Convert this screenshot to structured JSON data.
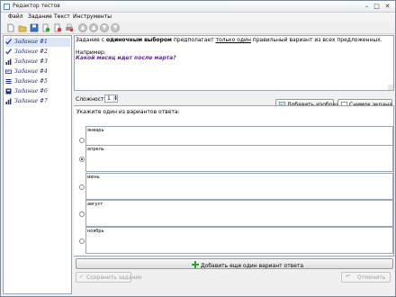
{
  "window": {
    "title": "Редактор тестов",
    "minimize": "–",
    "maximize": "□",
    "close": "✕"
  },
  "menu": [
    "Файл",
    "Задание",
    "Текст",
    "Инструменты"
  ],
  "toolbar": {
    "icons": [
      "new-file-icon",
      "open-folder-icon",
      "save-icon",
      "add-task-icon",
      "delete-task-icon",
      "print-icon"
    ],
    "nav": [
      "▲",
      "▲",
      "▼",
      "▼"
    ]
  },
  "tasks": [
    {
      "label": "Задание #1",
      "icon": "checkmark-icon"
    },
    {
      "label": "Задание #2",
      "icon": "checkmark-icon"
    },
    {
      "label": "Задание #3",
      "icon": "bar-chart-icon"
    },
    {
      "label": "Задание #4",
      "icon": "textfield-icon"
    },
    {
      "label": "Задание #5",
      "icon": "list-icon"
    },
    {
      "label": "Задание #6",
      "icon": "graduation-icon"
    },
    {
      "label": "Задание #7",
      "icon": "bar-chart-icon"
    }
  ],
  "description": {
    "part1": "Задание с ",
    "bold": "одиночным выбором",
    "part2": " предполагает ",
    "underlined": "только один",
    "part3": " правильный вариант из всех предложенных.",
    "example_label": "Например:",
    "question": "Какой месяц идет после марта?"
  },
  "settings": {
    "difficulty_label": "Сложность:",
    "difficulty_value": "1",
    "add_image": "Добавить изображение",
    "screenshot": "Снимок экрана"
  },
  "answers": {
    "hint": "Укажите один из вариантов ответа:",
    "items": [
      {
        "text": "январь",
        "selected": false
      },
      {
        "text": "апрель",
        "selected": true
      },
      {
        "text": "июнь",
        "selected": false
      },
      {
        "text": "август",
        "selected": false
      },
      {
        "text": "ноябрь",
        "selected": false
      }
    ],
    "add_variant": "Добавить еще один вариант ответа"
  },
  "bottom": {
    "save": "Сохранить задание",
    "cancel": "Отменить"
  },
  "colors": {
    "question": "#6a1fb3",
    "task_label": "#1c2a78",
    "accent_green": "#2aa52a"
  }
}
